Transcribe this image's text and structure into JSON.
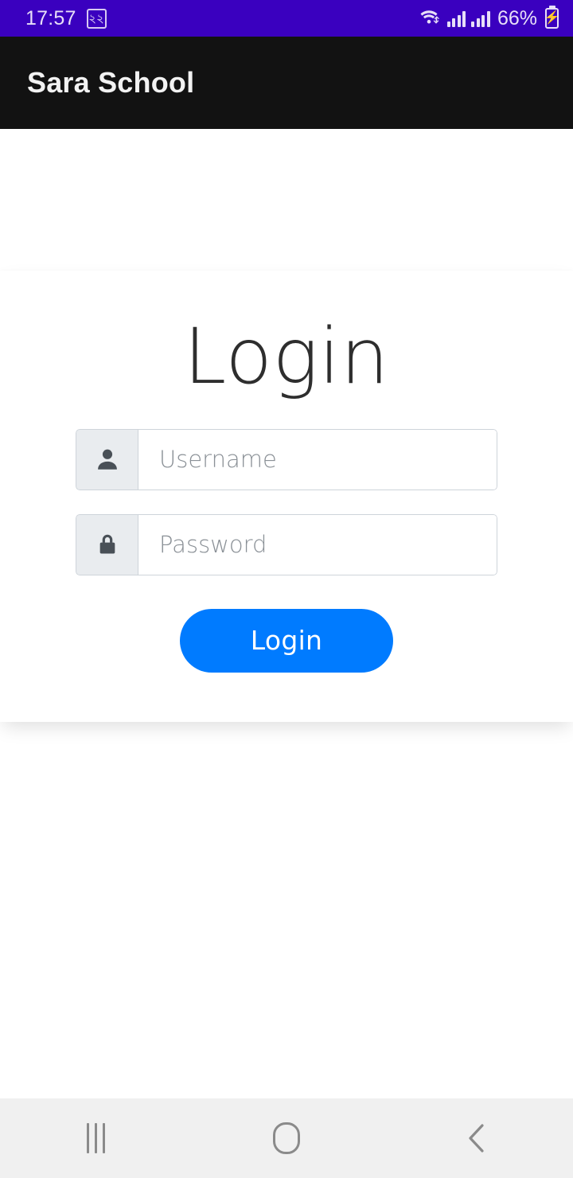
{
  "status_bar": {
    "time": "17:57",
    "badge_text": "২২",
    "battery_percent": "66%",
    "background_color": "#3a00bf",
    "foreground_color": "#e8dff8",
    "icons": [
      "wifi-icon",
      "signal-bars-icon",
      "signal-bars-icon",
      "battery-charging-icon"
    ]
  },
  "app_bar": {
    "title": "Sara School",
    "background_color": "#121212",
    "text_color": "#f2f2f2"
  },
  "login_card": {
    "heading": "Login",
    "username_field": {
      "placeholder": "Username",
      "value": "",
      "icon": "person-icon"
    },
    "password_field": {
      "placeholder": "Password",
      "value": "",
      "icon": "lock-icon"
    },
    "submit_button": {
      "label": "Login",
      "background_color": "#007bff",
      "text_color": "#ffffff"
    }
  },
  "nav_bar": {
    "background_color": "#f0f0f0",
    "items": [
      {
        "name": "recents",
        "icon": "recents-icon"
      },
      {
        "name": "home",
        "icon": "home-icon"
      },
      {
        "name": "back",
        "icon": "chevron-left-icon"
      }
    ]
  }
}
